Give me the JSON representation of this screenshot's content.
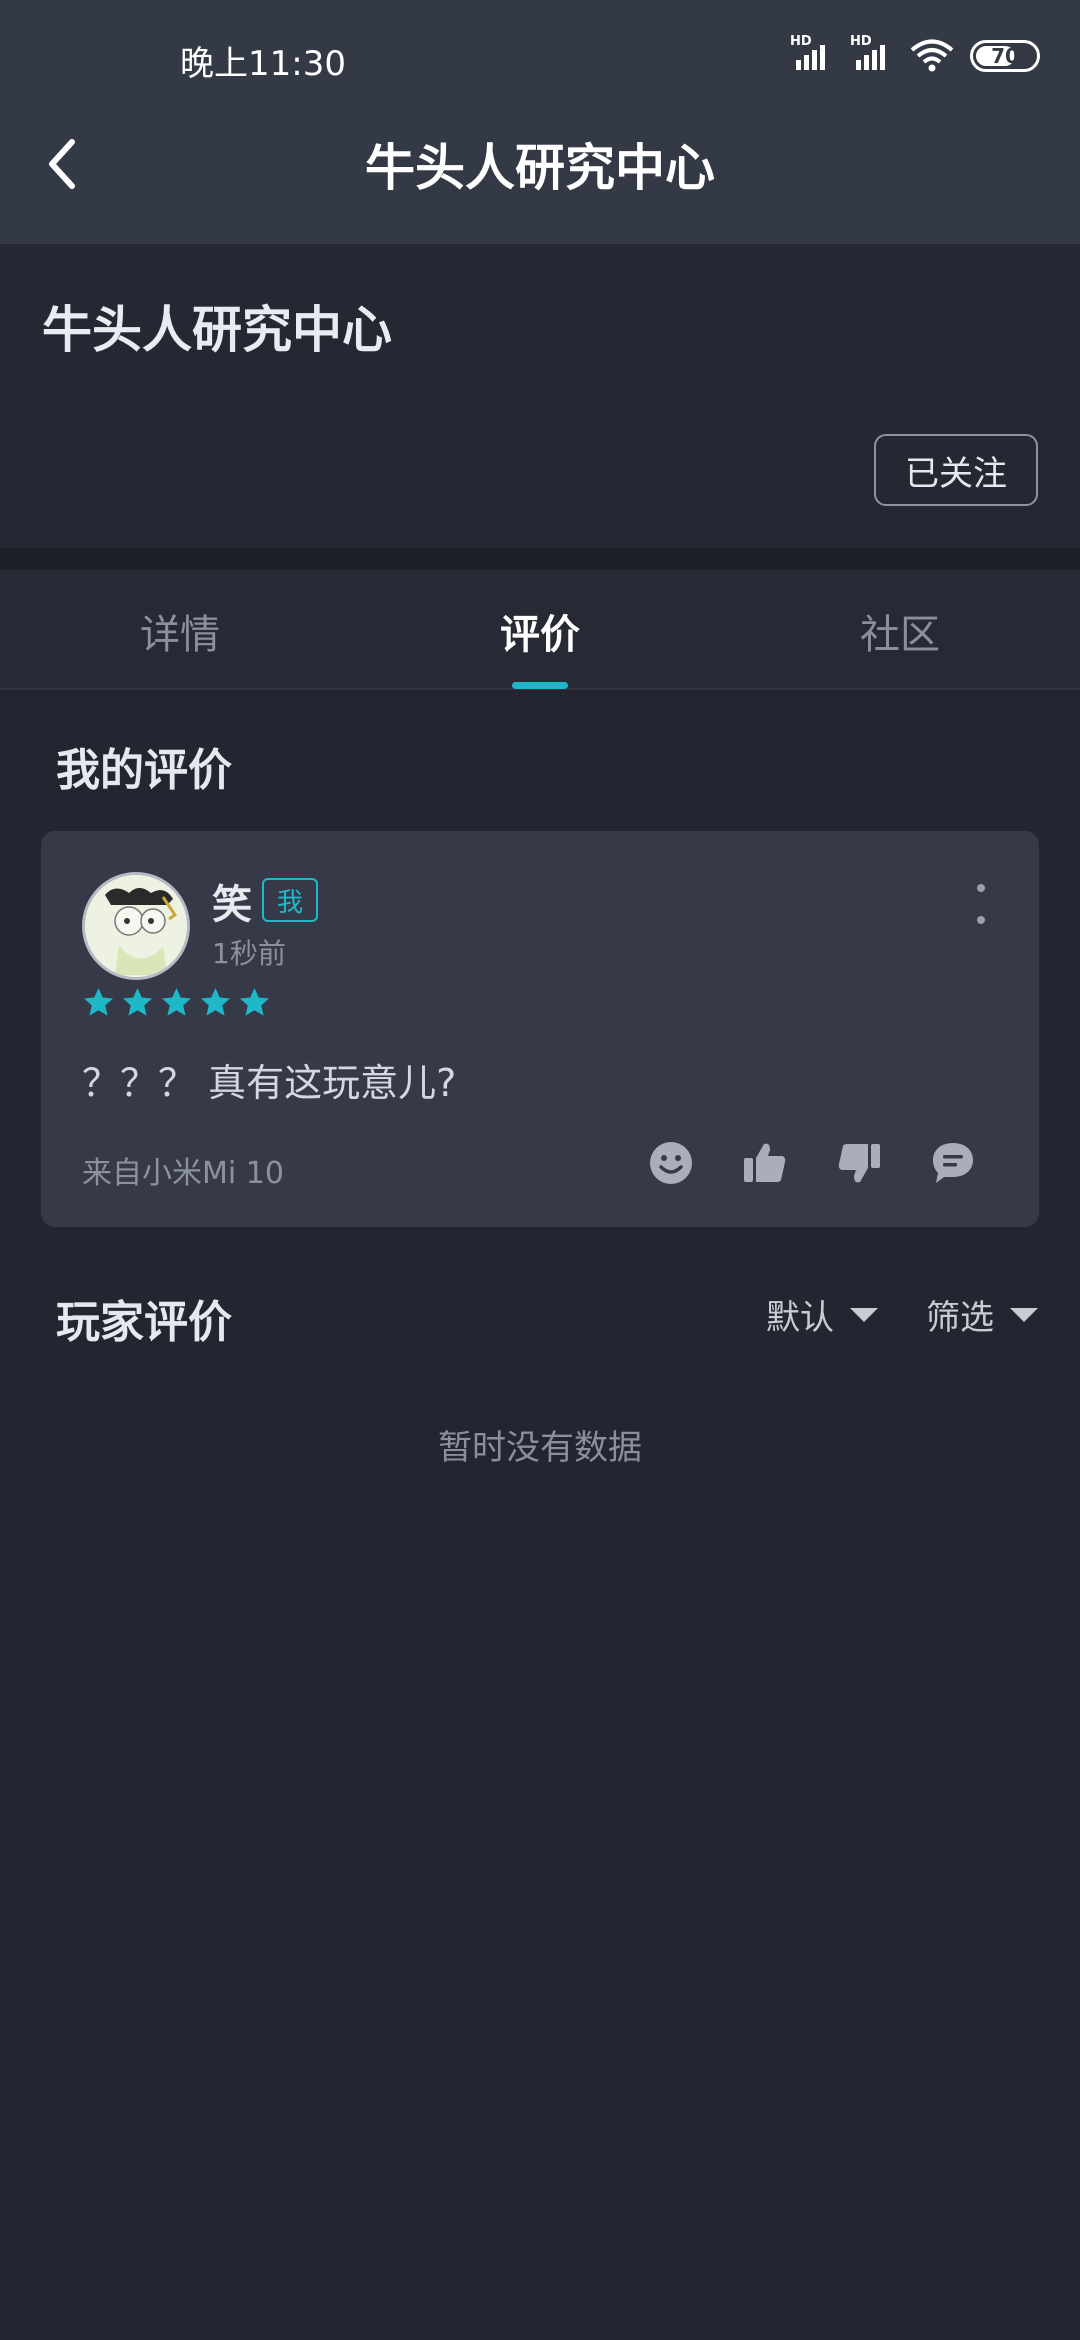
{
  "status_bar": {
    "time": "晚上11:30",
    "signal1_label": "HD",
    "signal2_label": "HD",
    "battery": "70",
    "battery_level": 0.7
  },
  "nav": {
    "title": "牛头人研究中心",
    "back_icon": "chevron-left-icon"
  },
  "header": {
    "name": "牛头人研究中心",
    "follow_label": "已关注"
  },
  "tabs": [
    {
      "label": "详情"
    },
    {
      "label": "评价",
      "active": true
    },
    {
      "label": "社区"
    }
  ],
  "my_review": {
    "section_title": "我的评价",
    "username": "笑",
    "me_badge": "我",
    "time": "1秒前",
    "rating": 5,
    "text": "？？？ 真有这玩意儿?",
    "device": "来自小米Mi 10",
    "actions": [
      "smile-icon",
      "thumbs-up-icon",
      "thumbs-down-icon",
      "comment-icon"
    ],
    "accent_color": "#1fb8c8"
  },
  "player_reviews": {
    "section_title": "玩家评价",
    "sort_label": "默认",
    "filter_label": "筛选",
    "empty_text": "暂时没有数据"
  }
}
